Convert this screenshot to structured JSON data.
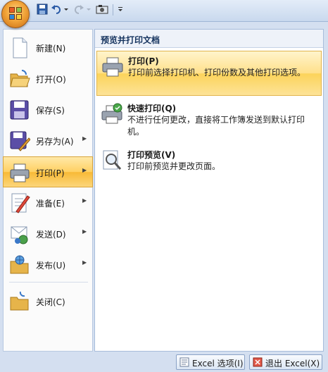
{
  "qat": {
    "office_button": "office-button",
    "items": [
      "save-icon",
      "undo-icon",
      "redo-icon",
      "camera-icon",
      "customize-icon"
    ]
  },
  "menu": {
    "items": [
      {
        "label": "新建(N)",
        "icon": "new-document-icon",
        "has_submenu": false
      },
      {
        "label": "打开(O)",
        "icon": "open-folder-icon",
        "has_submenu": false
      },
      {
        "label": "保存(S)",
        "icon": "save-disk-icon",
        "has_submenu": false
      },
      {
        "label": "另存为(A)",
        "icon": "save-as-icon",
        "has_submenu": true
      },
      {
        "label": "打印(P)",
        "icon": "printer-icon",
        "has_submenu": true,
        "active": true
      },
      {
        "label": "准备(E)",
        "icon": "prepare-icon",
        "has_submenu": true
      },
      {
        "label": "发送(D)",
        "icon": "send-icon",
        "has_submenu": true
      },
      {
        "label": "发布(U)",
        "icon": "publish-icon",
        "has_submenu": true
      },
      {
        "label": "关闭(C)",
        "icon": "close-folder-icon",
        "has_submenu": false
      }
    ]
  },
  "submenu": {
    "header": "预览并打印文档",
    "items": [
      {
        "title": "打印(P)",
        "desc": "打印前选择打印机、打印份数及其他打印选项。",
        "icon": "printer-icon",
        "active": true
      },
      {
        "title": "快速打印(Q)",
        "desc": "不进行任何更改，直接将工作簿发送到默认打印机。",
        "icon": "quick-print-icon"
      },
      {
        "title": "打印预览(V)",
        "desc": "打印前预览并更改页面。",
        "icon": "print-preview-icon"
      }
    ]
  },
  "bottom": {
    "options_label": "Excel 选项(I)",
    "exit_label": "退出 Excel(X)"
  },
  "colors": {
    "active_gradient": "#ffd062",
    "header_text": "#15335e",
    "frame": "#d4dff0"
  }
}
